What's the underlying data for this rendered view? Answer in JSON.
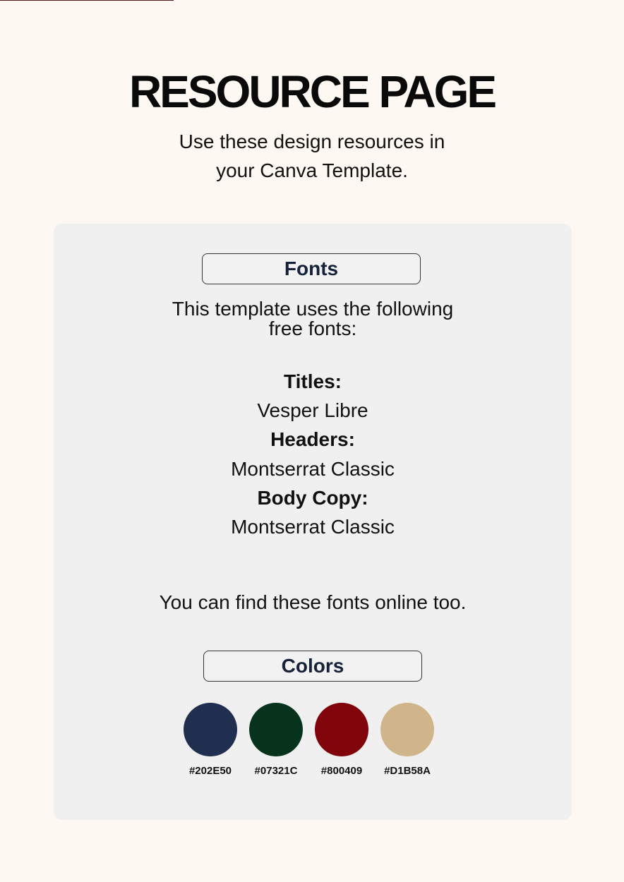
{
  "header": {
    "title": "RESOURCE PAGE",
    "subtitle_line1": "Use these design resources in",
    "subtitle_line2": "your Canva Template."
  },
  "fonts_section": {
    "heading": "Fonts",
    "intro_line1": "This template uses the following",
    "intro_line2": "free fonts:",
    "items": [
      {
        "label": "Titles:",
        "value": "Vesper Libre"
      },
      {
        "label": "Headers:",
        "value": "Montserrat Classic"
      },
      {
        "label": "Body Copy:",
        "value": "Montserrat Classic"
      }
    ],
    "footer_note": "You can find these fonts online too."
  },
  "colors_section": {
    "heading": "Colors",
    "swatches": [
      {
        "hex": "#202E50",
        "color": "#202E50"
      },
      {
        "hex": "#07321C",
        "color": "#07321C"
      },
      {
        "hex": "#800409",
        "color": "#800409"
      },
      {
        "hex": "#D1B58A",
        "color": "#D1B58A"
      }
    ]
  },
  "theme": {
    "page_background": "#fdf8f2",
    "panel_background": "#f0f0f0",
    "heading_text": "#16213a",
    "top_rule": "#5a1a1e"
  }
}
